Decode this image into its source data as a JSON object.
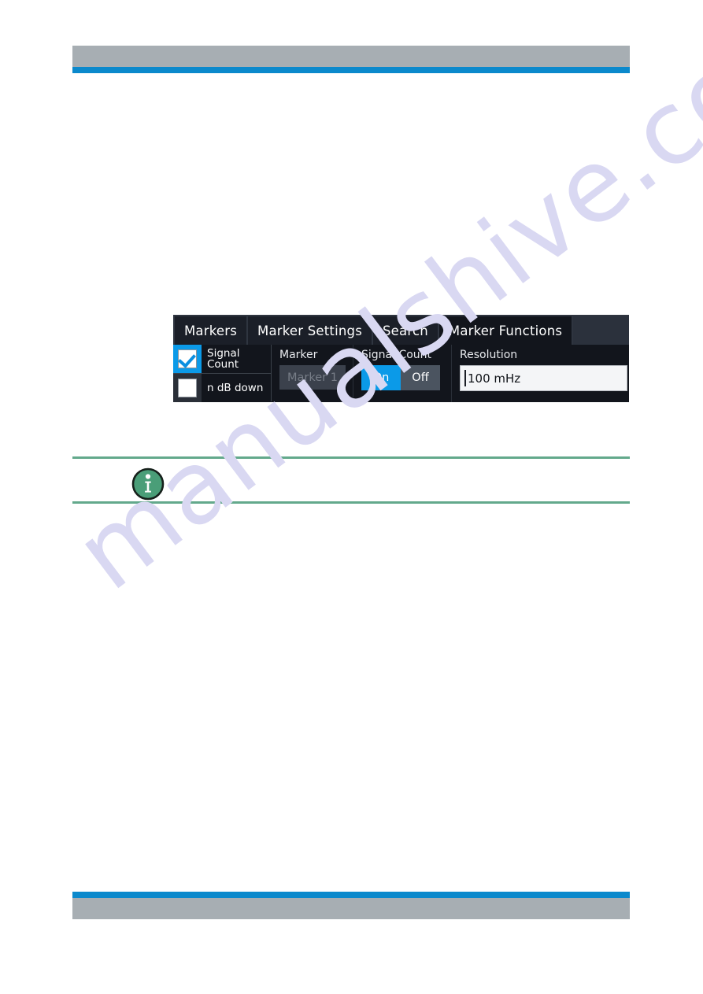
{
  "page": {
    "background_color": "#ffffff",
    "accent_rule_color": "#0b89cc",
    "band_color": "#a7aeb3",
    "watermark_text": "manualshive.com",
    "watermark_color": "#d9d8f2"
  },
  "note": {
    "icon_name": "info-icon",
    "icon_color": "#4a9e78",
    "rule_color": "#63a98c",
    "body_text": ""
  },
  "dialog": {
    "name": "marker-functions-dialog",
    "tabs": [
      {
        "label": "Markers",
        "selected": false
      },
      {
        "label": "Marker Settings",
        "selected": false
      },
      {
        "label": "Search",
        "selected": false
      },
      {
        "label": "Marker Functions",
        "selected": true
      }
    ],
    "checkboxes": [
      {
        "label_line1": "Signal",
        "label_line2": "Count",
        "checked": true,
        "highlight_color": "#0b9ae8"
      },
      {
        "label_line1": "n dB down",
        "label_line2": "",
        "checked": false,
        "highlight_color": "#2a2f38"
      }
    ],
    "marker_field": {
      "label": "Marker",
      "value": "Marker 1",
      "enabled": false
    },
    "signal_count_field": {
      "label": "Signal Count",
      "on_label": "On",
      "off_label": "Off",
      "selected": "On",
      "active_color": "#0b9ae8"
    },
    "resolution_field": {
      "label": "Resolution",
      "value": "100 mHz"
    }
  }
}
